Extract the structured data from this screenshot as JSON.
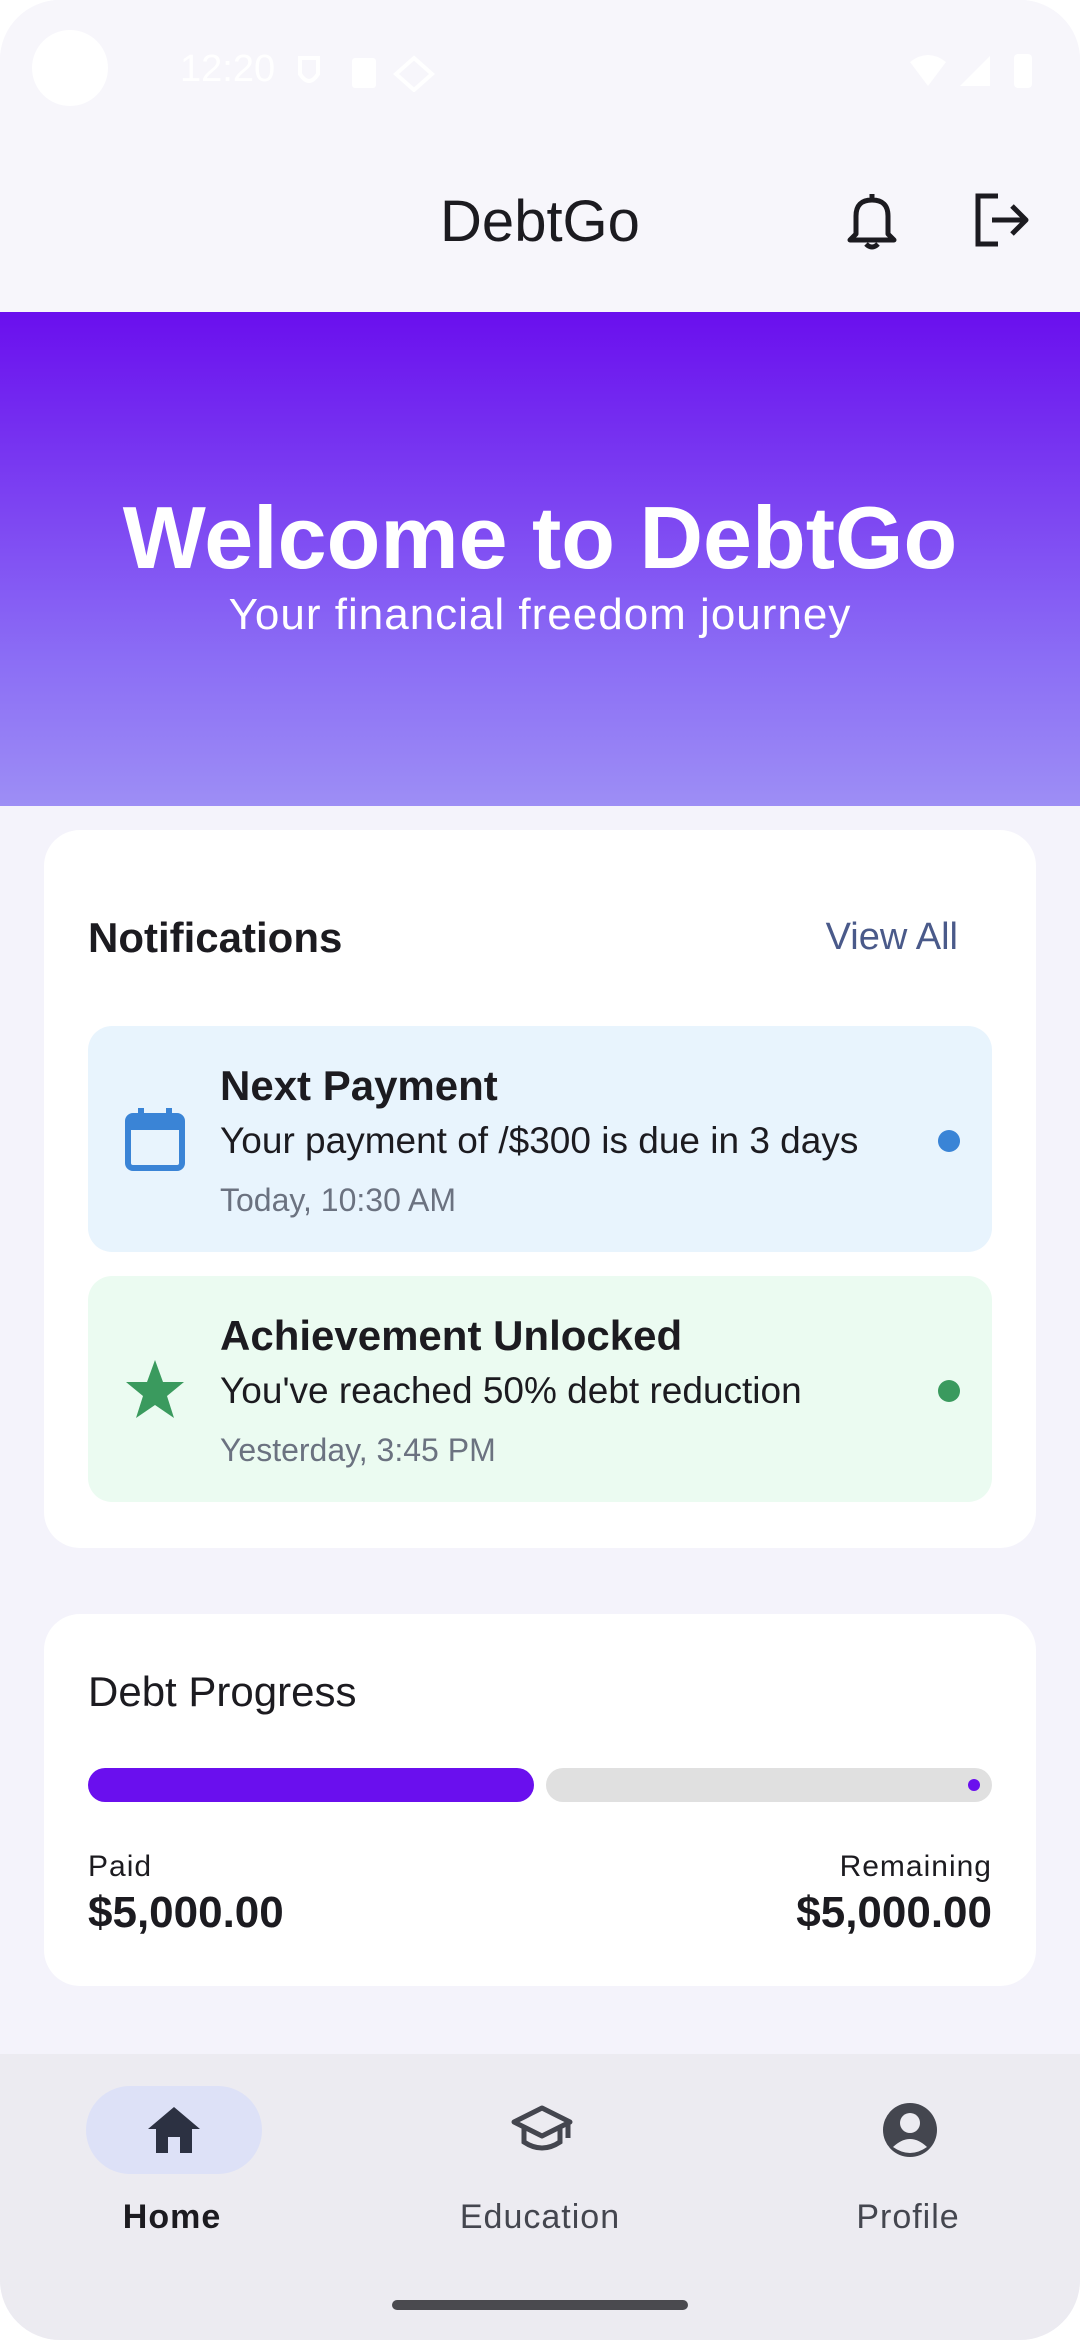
{
  "status_bar": {
    "time": "12:20"
  },
  "app_bar": {
    "title": "DebtGo",
    "icons": [
      "bell-icon",
      "logout-icon"
    ]
  },
  "hero": {
    "title": "Welcome to DebtGo",
    "subtitle": "Your financial freedom journey",
    "gradient_colors": [
      "#6a0fee",
      "#9d8ef5"
    ]
  },
  "notifications": {
    "heading": "Notifications",
    "view_all_label": "View All",
    "items": [
      {
        "title": "Next Payment",
        "message": "Your payment of /$300 is due in 3 days",
        "time": "Today, 10:30 AM",
        "icon": "calendar-icon",
        "color": "#3a84d6",
        "background": "#e8f4fd"
      },
      {
        "title": "Achievement Unlocked",
        "message": "You've reached 50% debt reduction",
        "time": "Yesterday, 3:45 PM",
        "icon": "star-icon",
        "color": "#3a9a5e",
        "background": "#ebfbf1"
      }
    ]
  },
  "debt_progress": {
    "heading": "Debt Progress",
    "paid_fraction": 0.5,
    "paid_label": "Paid",
    "paid_amount": "$5,000.00",
    "remaining_label": "Remaining",
    "remaining_amount": "$5,000.00",
    "accent_color": "#6a0fee"
  },
  "bottom_nav": {
    "items": [
      {
        "label": "Home",
        "icon": "home-icon",
        "active": true
      },
      {
        "label": "Education",
        "icon": "graduation-cap-icon",
        "active": false
      },
      {
        "label": "Profile",
        "icon": "account-circle-icon",
        "active": false
      }
    ]
  }
}
